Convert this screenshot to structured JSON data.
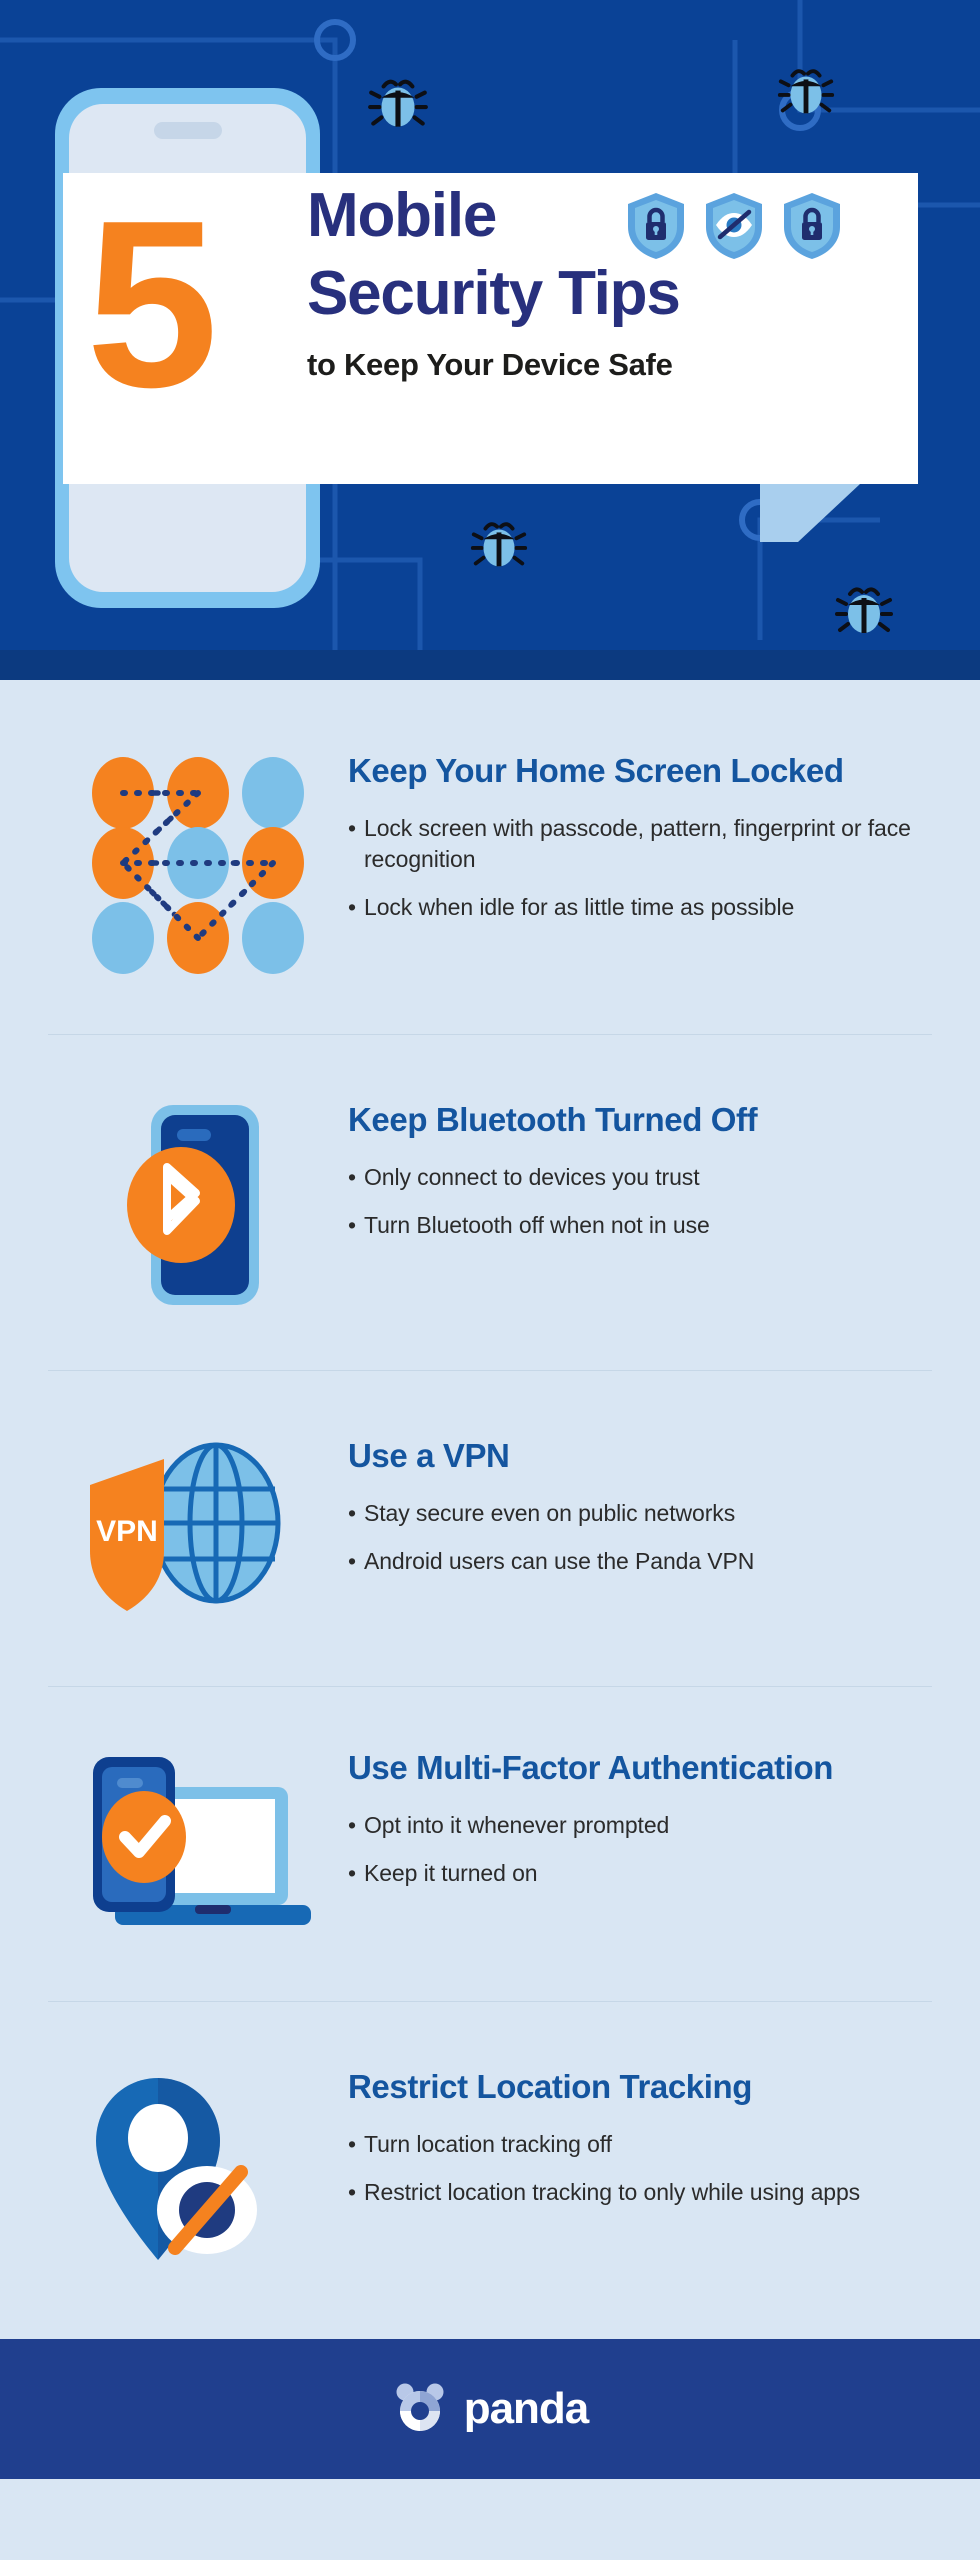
{
  "header": {
    "number": "5",
    "title_line1": "Mobile",
    "title_line2": "Security Tips",
    "subtitle": "to Keep Your Device Safe",
    "shields": [
      {
        "name": "shield-lock-icon"
      },
      {
        "name": "shield-eye-slash-icon"
      },
      {
        "name": "shield-lock-icon"
      }
    ],
    "decorations": [
      "bug-icon",
      "bug-icon",
      "bug-icon",
      "bug-icon",
      "circuit-trace",
      "phone-mockup"
    ],
    "colors": {
      "background": "#0a4296",
      "dark_band": "#0c3a80",
      "banner": "#ffffff",
      "number_orange": "#f5821f",
      "title_navy": "#28307d",
      "phone_frame": "#7ec4ef",
      "phone_screen": "#dde7f3"
    }
  },
  "tips": [
    {
      "id": "tip-home-screen-locked",
      "icon": "pattern-lock-icon",
      "title": "Keep Your Home Screen Locked",
      "bullets": [
        "Lock screen with passcode, pattern, fingerprint or face recognition",
        "Lock when idle for as little time as possible"
      ]
    },
    {
      "id": "tip-bluetooth-off",
      "icon": "phone-bluetooth-icon",
      "title": "Keep Bluetooth Turned Off",
      "bullets": [
        "Only connect to devices you trust",
        "Turn Bluetooth off when not in use"
      ]
    },
    {
      "id": "tip-use-vpn",
      "icon": "vpn-shield-globe-icon",
      "icon_label": "VPN",
      "title": "Use a VPN",
      "bullets": [
        "Stay secure even on public networks",
        "Android users can use the Panda VPN"
      ]
    },
    {
      "id": "tip-multi-factor-auth",
      "icon": "laptop-phone-check-icon",
      "title": "Use Multi-Factor Authentication",
      "bullets": [
        "Opt into it whenever prompted",
        "Keep it turned on"
      ]
    },
    {
      "id": "tip-restrict-location",
      "icon": "location-pin-eye-slash-icon",
      "title": "Restrict Location Tracking",
      "bullets": [
        "Turn location tracking off",
        "Restrict location tracking to only while using apps"
      ]
    }
  ],
  "footer": {
    "brand": "panda",
    "logo_icon": "panda-ring-icon",
    "background": "#203f8e"
  },
  "theme": {
    "page_background": "#d9e6f3",
    "heading_blue": "#14559f",
    "body_text": "#2b2b2b",
    "orange": "#f5821f",
    "light_blue": "#7ec4ef",
    "divider": "#c6d7e7"
  }
}
